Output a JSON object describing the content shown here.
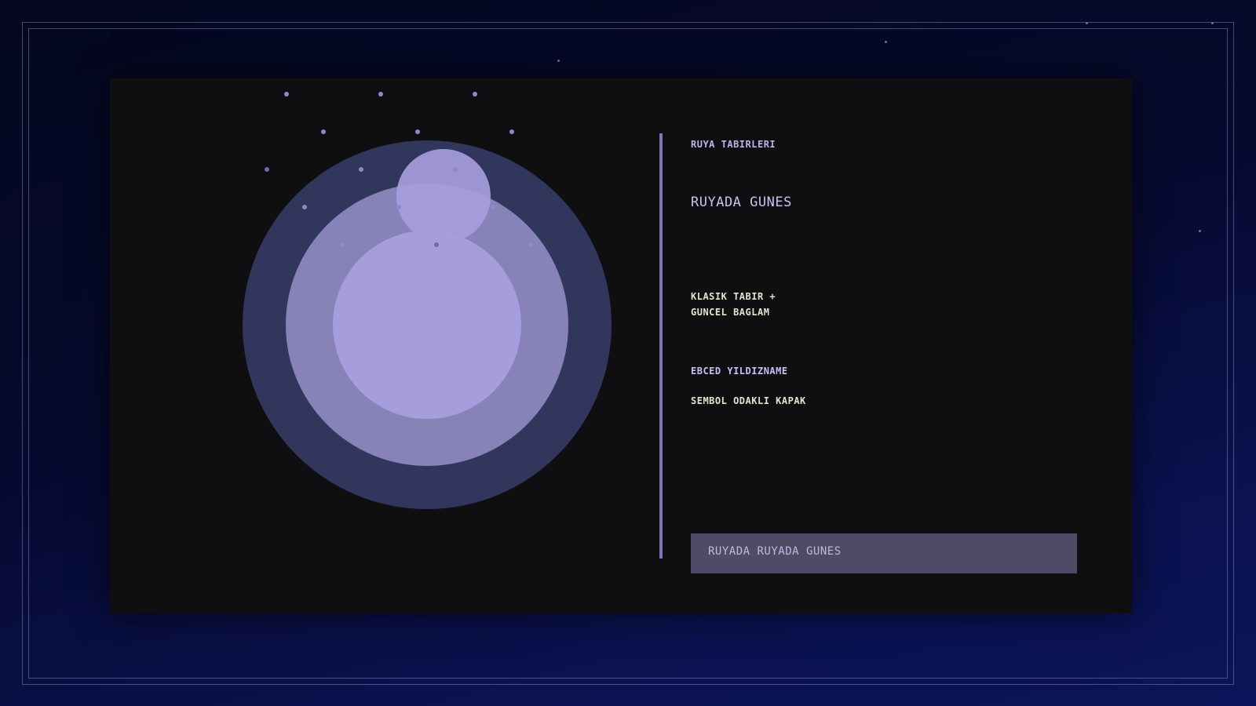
{
  "colors": {
    "background_top": "#05071f",
    "background_bottom": "#0b1458",
    "panel": "#0f0f11",
    "orb_outer": "#31365d",
    "orb_middle": "#8783b8",
    "orb_inner": "#a69ddc",
    "orb_small": "#a69ddc",
    "divider": "#7a78b8",
    "banner": "#4f4a66",
    "accent_text": "#c4c0f4",
    "body_text": "#e6e0cc"
  },
  "header": {
    "kicker": "RUYA TABIRLERI",
    "title": "RUYADA GUNES"
  },
  "description": {
    "line1": "KLASIK TABIR +",
    "line2": "GUNCEL BAGLAM"
  },
  "meta": {
    "brand": "EBCED YILDIZNAME",
    "tagline": "SEMBOL ODAKLI KAPAK"
  },
  "banner": {
    "text": "RUYADA RUYADA GUNES"
  }
}
